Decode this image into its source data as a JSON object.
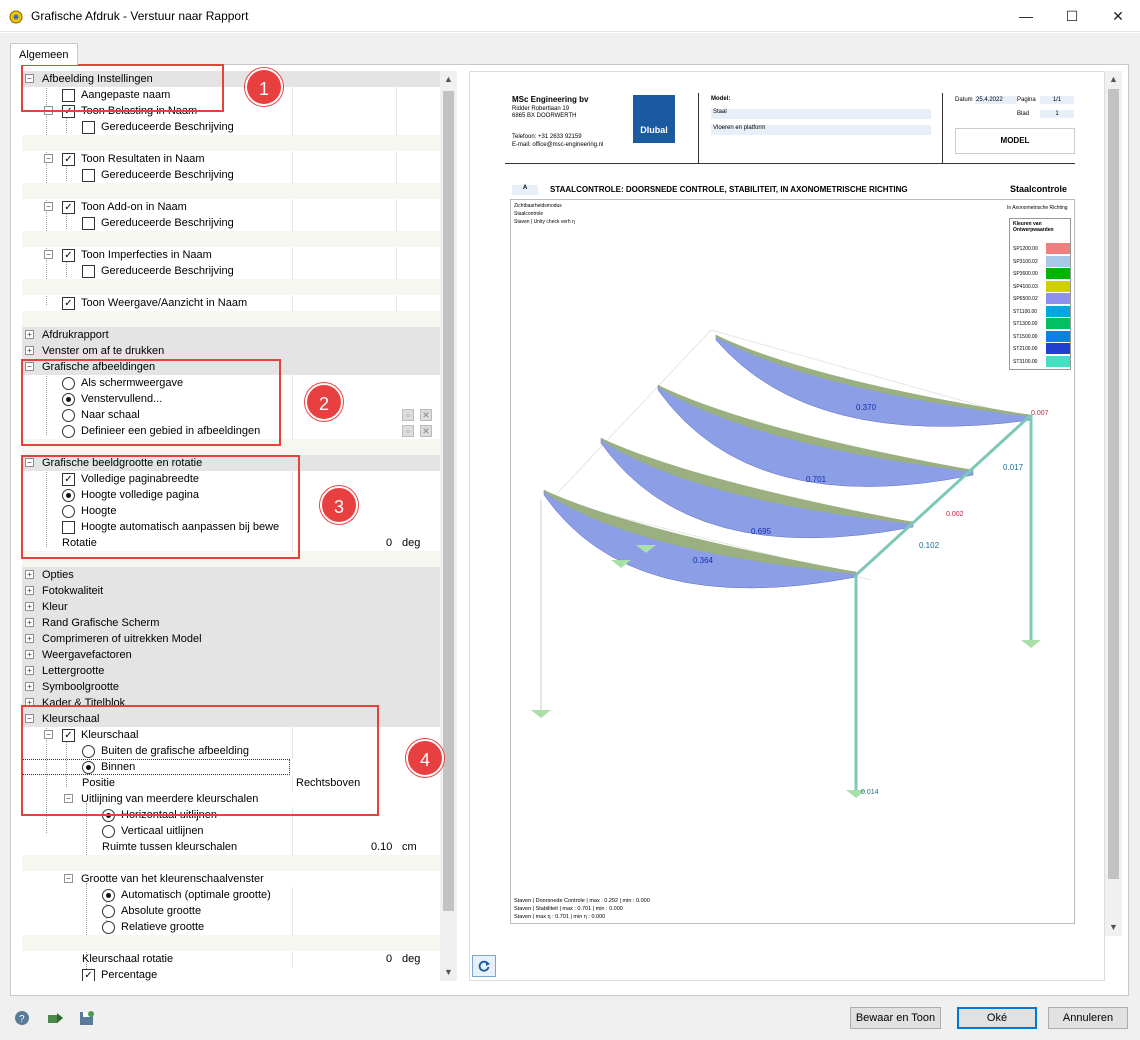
{
  "window": {
    "title": "Grafische Afdruk - Verstuur naar Rapport",
    "minimize": "—",
    "maximize": "☐",
    "close": "✕"
  },
  "tab": {
    "label": "Algemeen"
  },
  "tree": {
    "afbeelding": {
      "header": "Afbeelding Instellingen",
      "aangepaste": "Aangepaste naam",
      "belasting": "Toon Belasting in Naam",
      "gered1": "Gereduceerde Beschrijving",
      "resultaten": "Toon Resultaten in Naam",
      "gered2": "Gereduceerde Beschrijving",
      "addon": "Toon Add-on in Naam",
      "gered3": "Gereduceerde Beschrijving",
      "imperfecties": "Toon Imperfecties in Naam",
      "gered4": "Gereduceerde Beschrijving",
      "weergave": "Toon Weergave/Aanzicht in Naam"
    },
    "afdrukrapport": "Afdrukrapport",
    "venster": "Venster om af te drukken",
    "grafisch": {
      "header": "Grafische afbeeldingen",
      "scherm": "Als schermweergave",
      "vullend": "Venstervullend...",
      "schaal": "Naar schaal",
      "gebied": "Definieer een gebied in afbeeldingen"
    },
    "grootte": {
      "header": "Grafische beeldgrootte en rotatie",
      "breedte": "Volledige paginabreedte",
      "hoogte_vol": "Hoogte volledige pagina",
      "hoogte": "Hoogte",
      "auto": "Hoogte automatisch aanpassen bij bewe",
      "rotatie": "Rotatie",
      "rotatie_val": "0",
      "rotatie_unit": "deg"
    },
    "opties": "Opties",
    "foto": "Fotokwaliteit",
    "kleur": "Kleur",
    "rand": "Rand Grafische Scherm",
    "comprimeren": "Comprimeren of uitrekken Model",
    "factoren": "Weergavefactoren",
    "letter": "Lettergrootte",
    "symbool": "Symboolgrootte",
    "kader": "Kader & Titelblok",
    "kleurschaal": {
      "header": "Kleurschaal",
      "kleurschaal": "Kleurschaal",
      "buiten": "Buiten de grafische afbeelding",
      "binnen": "Binnen",
      "positie": "Positie",
      "positie_val": "Rechtsboven",
      "uitlijning": "Uitlijning van meerdere kleurschalen",
      "horizontaal": "Horizontaal uitlijnen",
      "verticaal": "Verticaal uitlijnen",
      "ruimte": "Ruimte tussen kleurschalen",
      "ruimte_val": "0.10",
      "ruimte_unit": "cm",
      "grootte": "Grootte van het kleurenschaalvenster",
      "automatisch": "Automatisch (optimale grootte)",
      "absolute": "Absolute grootte",
      "relatieve": "Relatieve grootte",
      "rotatie": "Kleurschaal rotatie",
      "rotatie_val": "0",
      "rotatie_unit": "deg",
      "percentage": "Percentage"
    }
  },
  "badges": [
    "1",
    "2",
    "3",
    "4"
  ],
  "preview": {
    "company": "MSc Engineering bv",
    "addr1": "Ridder Robertlaan 19",
    "addr2": "6865 BX DOORWERTH",
    "phone": "Telefoon: +31 2633 92159",
    "email": "E-mail: office@msc-engineering.nl",
    "logo": "Dlubal",
    "model_label": "Model:",
    "model1": "Staal",
    "model2": "Vloeren en platform",
    "datum_label": "Datum",
    "datum": "25.4.2022",
    "pagina_label": "Pagina",
    "pagina": "1/1",
    "blad_label": "Blad",
    "blad": "1",
    "model_box": "MODEL",
    "section_tag": "A",
    "section_title": "STAALCONTROLE: DOORSNEDE CONTROLE, STABILITEIT, IN AXONOMETRISCHE RICHTING",
    "section_right": "Staalcontrole",
    "img_l1": "Zichtbaarheidsmodus",
    "img_l2": "Staalcontrole",
    "img_l3": "Staven | Unity check verh η",
    "img_r1": "In Axonometrische Richting",
    "legend_title": "Kleuren van Ontwerpwaarden",
    "legend": [
      {
        "name": "SP1200.00",
        "color": "#f08080"
      },
      {
        "name": "SP3100.02",
        "color": "#a8c8e8"
      },
      {
        "name": "SP3600.00",
        "color": "#00b400"
      },
      {
        "name": "SP4100.03",
        "color": "#d0d000"
      },
      {
        "name": "SP6500.02",
        "color": "#9090f0"
      },
      {
        "name": "ST1100.00",
        "color": "#00a8e0"
      },
      {
        "name": "ST1300.00",
        "color": "#00c060"
      },
      {
        "name": "ST1500.00",
        "color": "#1080e0"
      },
      {
        "name": "ST2100.00",
        "color": "#2040d0"
      },
      {
        "name": "ST3100.00",
        "color": "#40e0c0"
      }
    ],
    "values": {
      "v1": "0.370",
      "v2": "0.701",
      "v3": "0.695",
      "v4": "0.364",
      "v5": "0.017",
      "v6": "0.102",
      "v7": "0.007",
      "v8": "0.002",
      "v9": "0.014"
    },
    "foot1": "Staven | Doorsnede Controle | max : 0.292 | min : 0.000",
    "foot2": "Staven | Stabiliteit | max : 0.701 | min : 0.000",
    "foot3": "Staven | max η : 0.701 | min η : 0.000"
  },
  "buttons": {
    "save": "Bewaar en Toon",
    "ok": "Oké",
    "cancel": "Annuleren"
  },
  "colors": {
    "accent": "#0078d7",
    "badge": "#e84040",
    "beam": "#8c9ee6"
  }
}
